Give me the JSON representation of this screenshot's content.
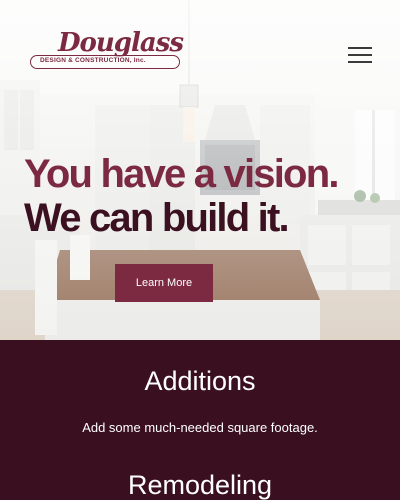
{
  "brand": {
    "logo_script": "Douglass",
    "logo_tagline": "DESIGN & CONSTRUCTION, Inc."
  },
  "nav": {
    "menu_icon": "hamburger-menu-icon"
  },
  "hero": {
    "headline_line1": "You have a vision.",
    "headline_line2": "We can build it.",
    "cta_label": "Learn More",
    "background_image": "kitchen-interior"
  },
  "services": [
    {
      "title": "Additions",
      "description": "Add some much-needed square footage."
    },
    {
      "title": "Remodeling"
    }
  ],
  "colors": {
    "accent": "#7c2a41",
    "dark": "#3b1021",
    "services_bg": "#3a1020"
  }
}
